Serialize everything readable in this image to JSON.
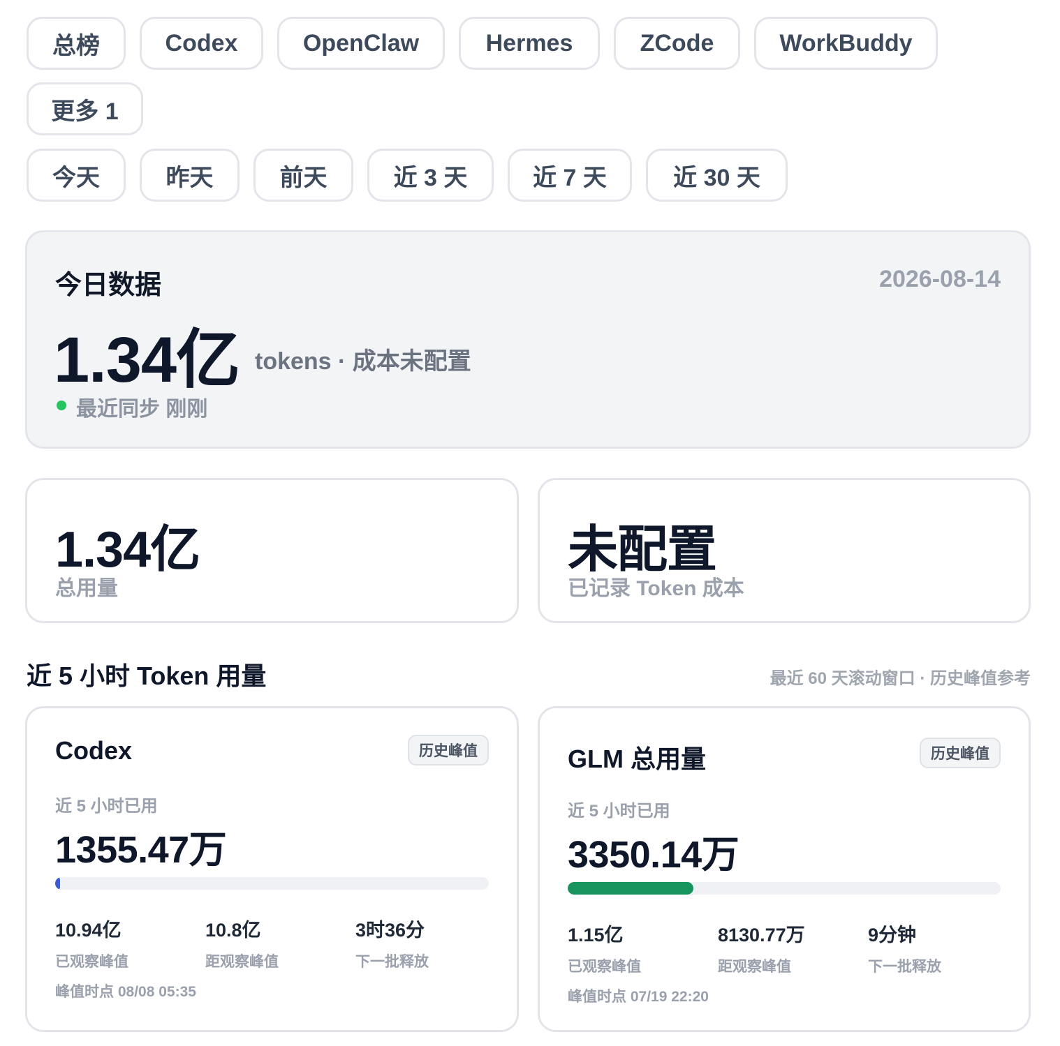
{
  "source_tabs": [
    {
      "label": "总榜",
      "active": true
    },
    {
      "label": "Codex",
      "active": false
    },
    {
      "label": "OpenClaw",
      "active": false
    },
    {
      "label": "Hermes",
      "active": false
    },
    {
      "label": "ZCode",
      "active": false
    },
    {
      "label": "WorkBuddy",
      "active": false
    },
    {
      "label": "更多 1",
      "active": false
    }
  ],
  "range_tabs": [
    {
      "label": "今天",
      "active": true
    },
    {
      "label": "昨天",
      "active": false
    },
    {
      "label": "前天",
      "active": false
    },
    {
      "label": "近 3 天",
      "active": false
    },
    {
      "label": "近 7 天",
      "active": false
    },
    {
      "label": "近 30 天",
      "active": false
    }
  ],
  "hero": {
    "title": "今日数据",
    "date": "2026-08-14",
    "value": "1.34亿",
    "unit": "tokens · 成本未配置",
    "sync_text": "最近同步 刚刚",
    "sync_color": "#22c55e"
  },
  "stats": [
    {
      "value": "1.34亿",
      "label": "总用量"
    },
    {
      "value": "未配置",
      "label": "已记录 Token 成本"
    }
  ],
  "section": {
    "title": "近 5 小时 Token 用量",
    "note": "最近 60 天滚动窗口 · 历史峰值参考"
  },
  "meters": [
    {
      "title": "Codex",
      "badge": "历史峰值",
      "sub": "近 5 小时已用",
      "value": "1355.47万",
      "progress_fraction": 0.012,
      "bar_color": "#3b5bdb",
      "stats": [
        {
          "value": "10.94亿",
          "label": "已观察峰值"
        },
        {
          "value": "10.8亿",
          "label": "距观察峰值"
        },
        {
          "value": "3时36分",
          "label": "下一批释放"
        }
      ],
      "peak": "峰值时点 08/08 05:35"
    },
    {
      "title": "GLM 总用量",
      "badge": "历史峰值",
      "sub": "近 5 小时已用",
      "value": "3350.14万",
      "progress_fraction": 0.29,
      "bar_color": "#16955f",
      "stats": [
        {
          "value": "1.15亿",
          "label": "已观察峰值"
        },
        {
          "value": "8130.77万",
          "label": "距观察峰值"
        },
        {
          "value": "9分钟",
          "label": "下一批释放"
        }
      ],
      "peak": "峰值时点 07/19 22:20"
    }
  ]
}
